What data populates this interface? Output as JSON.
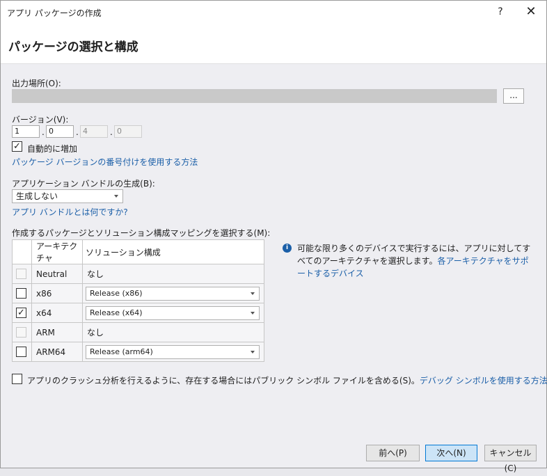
{
  "window": {
    "title": "アプリ パッケージの作成",
    "help_label": "?",
    "close_label": "✕"
  },
  "header": {
    "heading": "パッケージの選択と構成"
  },
  "output": {
    "label": "出力場所(O):",
    "value": "",
    "browse_label": "..."
  },
  "version": {
    "label": "バージョン(V):",
    "parts": [
      "1",
      "0",
      "4",
      "0"
    ],
    "separator": ".",
    "auto_increment_label": "自動的に増加",
    "auto_increment_checked": true,
    "numbering_link": "パッケージ バージョンの番号付けを使用する方法"
  },
  "bundle": {
    "label": "アプリケーション バンドルの生成(B):",
    "selected": "生成しない",
    "help_link": "アプリ バンドルとは何ですか?"
  },
  "mapping": {
    "label": "作成するパッケージとソリューション構成マッピングを選択する(M):",
    "headers": [
      "アーキテクチャ",
      "ソリューション構成"
    ],
    "rows": [
      {
        "arch": "Neutral",
        "config": "なし",
        "checked": false,
        "enabled": false,
        "dropdown": false
      },
      {
        "arch": "x86",
        "config": "Release (x86)",
        "checked": false,
        "enabled": true,
        "dropdown": true
      },
      {
        "arch": "x64",
        "config": "Release (x64)",
        "checked": true,
        "enabled": true,
        "dropdown": true
      },
      {
        "arch": "ARM",
        "config": "なし",
        "checked": false,
        "enabled": false,
        "dropdown": false
      },
      {
        "arch": "ARM64",
        "config": "Release (arm64)",
        "checked": false,
        "enabled": true,
        "dropdown": true
      }
    ]
  },
  "info": {
    "icon": "info-icon",
    "text": "可能な限り多くのデバイスで実行するには、アプリに対してすべてのアーキテクチャを選択します。",
    "link": "各アーキテクチャをサポートするデバイス"
  },
  "symbols": {
    "label": "アプリのクラッシュ分析を行えるように、存在する場合にはパブリック シンボル ファイルを含める(S)。",
    "checked": false,
    "link": "デバッグ シンボルを使用する方法"
  },
  "footer": {
    "prev_label": "前へ(P)",
    "next_label": "次へ(N)",
    "cancel_label": "キャンセル(C)"
  },
  "colors": {
    "accent": "#0078d4",
    "link": "#1b5fa8",
    "primary_button": "#cce4f7"
  }
}
